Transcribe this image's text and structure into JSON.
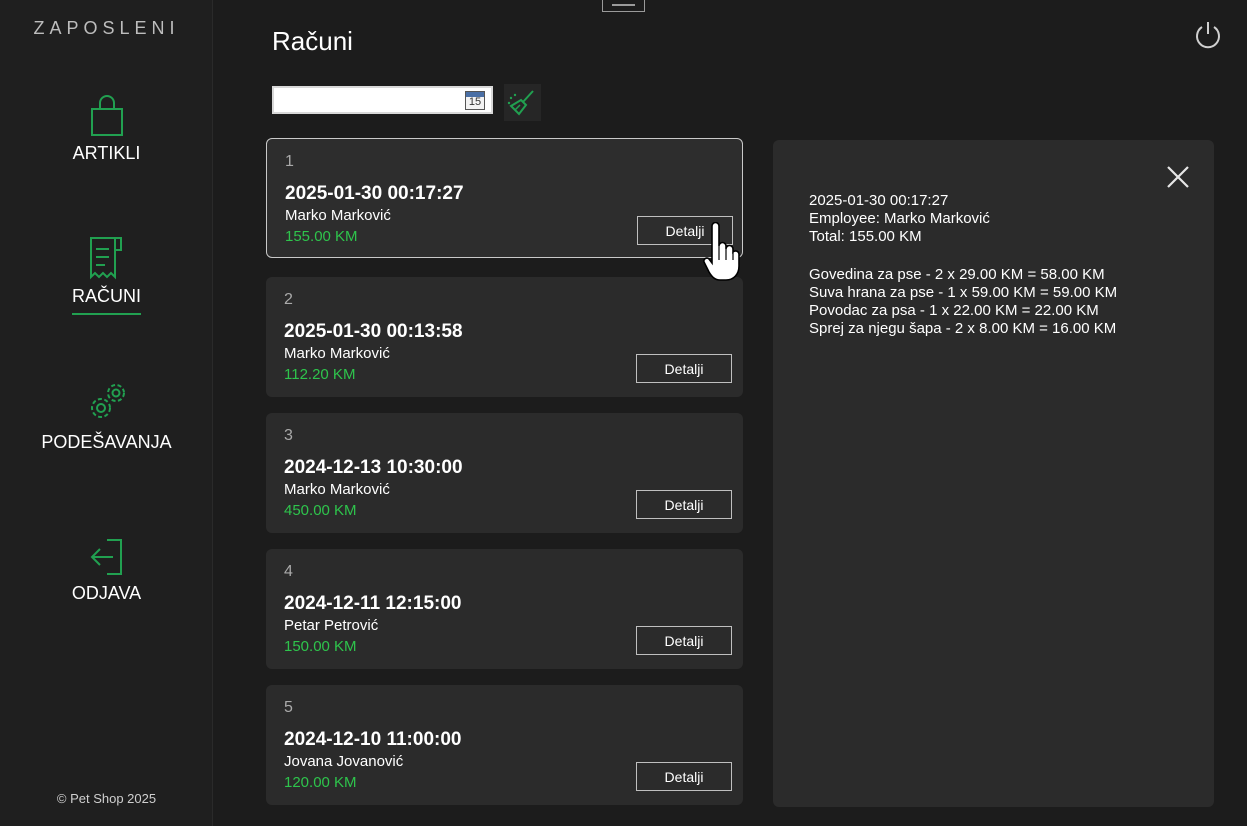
{
  "sidebar": {
    "brand": "ZAPOSLENI",
    "items": [
      {
        "label": "ARTIKLI",
        "icon": "shopping-bag-icon",
        "active": false
      },
      {
        "label": "RAČUNI",
        "icon": "receipt-icon",
        "active": true
      },
      {
        "label": "PODEŠAVANJA",
        "icon": "gears-icon",
        "active": false
      },
      {
        "label": "ODJAVA",
        "icon": "logout-icon",
        "active": false
      }
    ],
    "copyright": "© Pet Shop 2025"
  },
  "page": {
    "title": "Računi"
  },
  "filter": {
    "date_value": "",
    "calendar_label": "15"
  },
  "receipts": [
    {
      "num": "1",
      "date": "2025-01-30 00:17:27",
      "employee": "Marko Marković",
      "total": "155.00 KM",
      "details_label": "Detalji"
    },
    {
      "num": "2",
      "date": "2025-01-30 00:13:58",
      "employee": "Marko Marković",
      "total": "112.20 KM",
      "details_label": "Detalji"
    },
    {
      "num": "3",
      "date": "2024-12-13 10:30:00",
      "employee": "Marko Marković",
      "total": "450.00 KM",
      "details_label": "Detalji"
    },
    {
      "num": "4",
      "date": "2024-12-11 12:15:00",
      "employee": "Petar Petrović",
      "total": "150.00 KM",
      "details_label": "Detalji"
    },
    {
      "num": "5",
      "date": "2024-12-10 11:00:00",
      "employee": "Jovana Jovanović",
      "total": "120.00 KM",
      "details_label": "Detalji"
    }
  ],
  "details": {
    "date": "2025-01-30 00:17:27",
    "employee": "Employee: Marko Marković",
    "total": "Total: 155.00 KM",
    "lines": [
      "Govedina za pse - 2 x 29.00 KM = 58.00 KM",
      "Suva hrana za pse - 1 x 59.00 KM = 59.00 KM",
      "Povodac za psa - 1 x 22.00 KM = 22.00 KM",
      "Sprej za njegu šapa - 2 x 8.00 KM = 16.00 KM"
    ]
  },
  "colors": {
    "accent": "#21a050",
    "amount": "#2ec44c",
    "background": "#1c1c1c",
    "card": "#2b2b2b"
  }
}
